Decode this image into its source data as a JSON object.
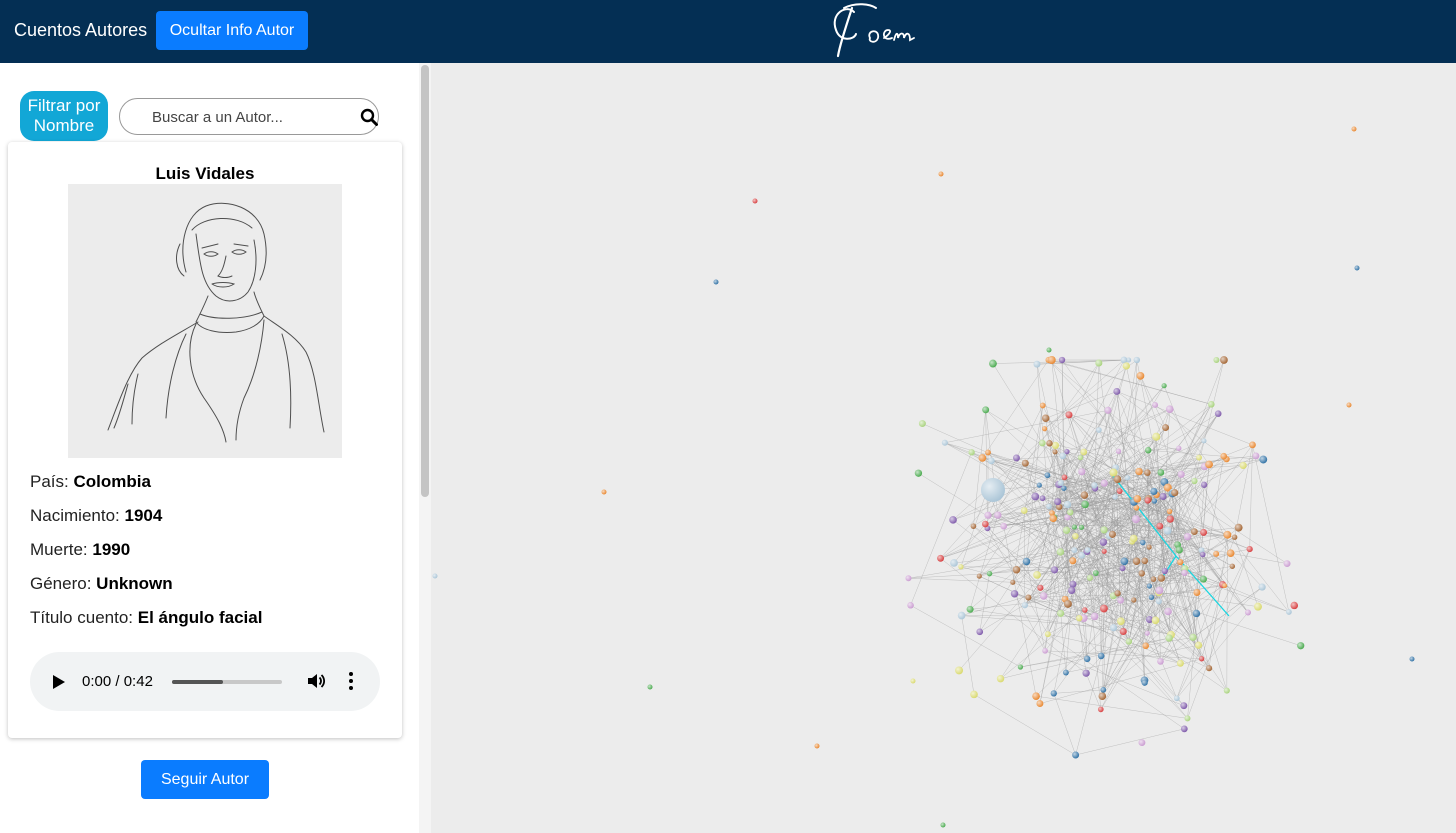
{
  "header": {
    "title": "Cuentos Autores",
    "toggle_info_label": "Ocultar Info Autor",
    "logo_text": "Coem"
  },
  "sidebar": {
    "filter_label": "Filtrar por Nombre",
    "search_placeholder": "Buscar a un Autor...",
    "follow_label": "Seguir Autor"
  },
  "author": {
    "name": "Luis Vidales",
    "country_label": "País:",
    "country": "Colombia",
    "birth_label": "Nacimiento:",
    "birth": "1904",
    "death_label": "Muerte:",
    "death": "1990",
    "gender_label": "Género:",
    "gender": "Unknown",
    "story_label": "Título cuento:",
    "story": "El ángulo facial"
  },
  "audio": {
    "current_time": "0:00",
    "separator": "/",
    "duration": "0:42",
    "buffered_fraction": 0.46
  },
  "colors": {
    "header_bg": "#042f54",
    "primary_button": "#0a7cff",
    "filter_button": "#12a7d6",
    "highlight_link": "#17d6e0",
    "node_palette": [
      "#a9c4d6",
      "#2b6ea3",
      "#45a84a",
      "#a6d17a",
      "#e8842a",
      "#d6393a",
      "#7b55a8",
      "#c99ad0",
      "#a2622f",
      "#d8d86a"
    ]
  }
}
